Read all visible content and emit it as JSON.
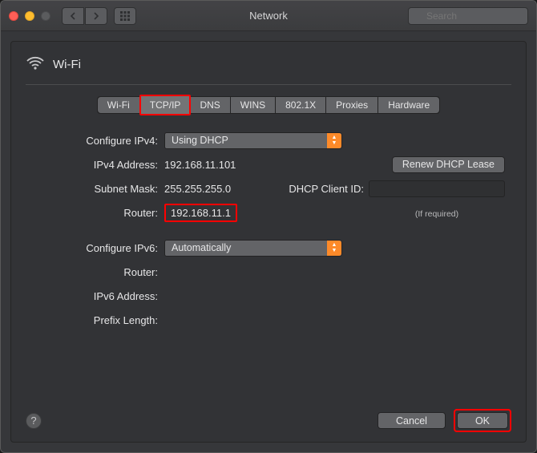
{
  "window": {
    "title": "Network",
    "search_placeholder": "Search"
  },
  "header": {
    "title": "Wi-Fi"
  },
  "tabs": {
    "items": [
      "Wi-Fi",
      "TCP/IP",
      "DNS",
      "WINS",
      "802.1X",
      "Proxies",
      "Hardware"
    ],
    "active_index": 1
  },
  "ipv4": {
    "configure_label": "Configure IPv4:",
    "configure_value": "Using DHCP",
    "address_label": "IPv4 Address:",
    "address_value": "192.168.11.101",
    "subnet_label": "Subnet Mask:",
    "subnet_value": "255.255.255.0",
    "router_label": "Router:",
    "router_value": "192.168.11.1",
    "renew_button": "Renew DHCP Lease",
    "client_id_label": "DHCP Client ID:",
    "client_id_note": "(If required)"
  },
  "ipv6": {
    "configure_label": "Configure IPv6:",
    "configure_value": "Automatically",
    "router_label": "Router:",
    "address_label": "IPv6 Address:",
    "prefix_label": "Prefix Length:"
  },
  "footer": {
    "cancel": "Cancel",
    "ok": "OK"
  }
}
